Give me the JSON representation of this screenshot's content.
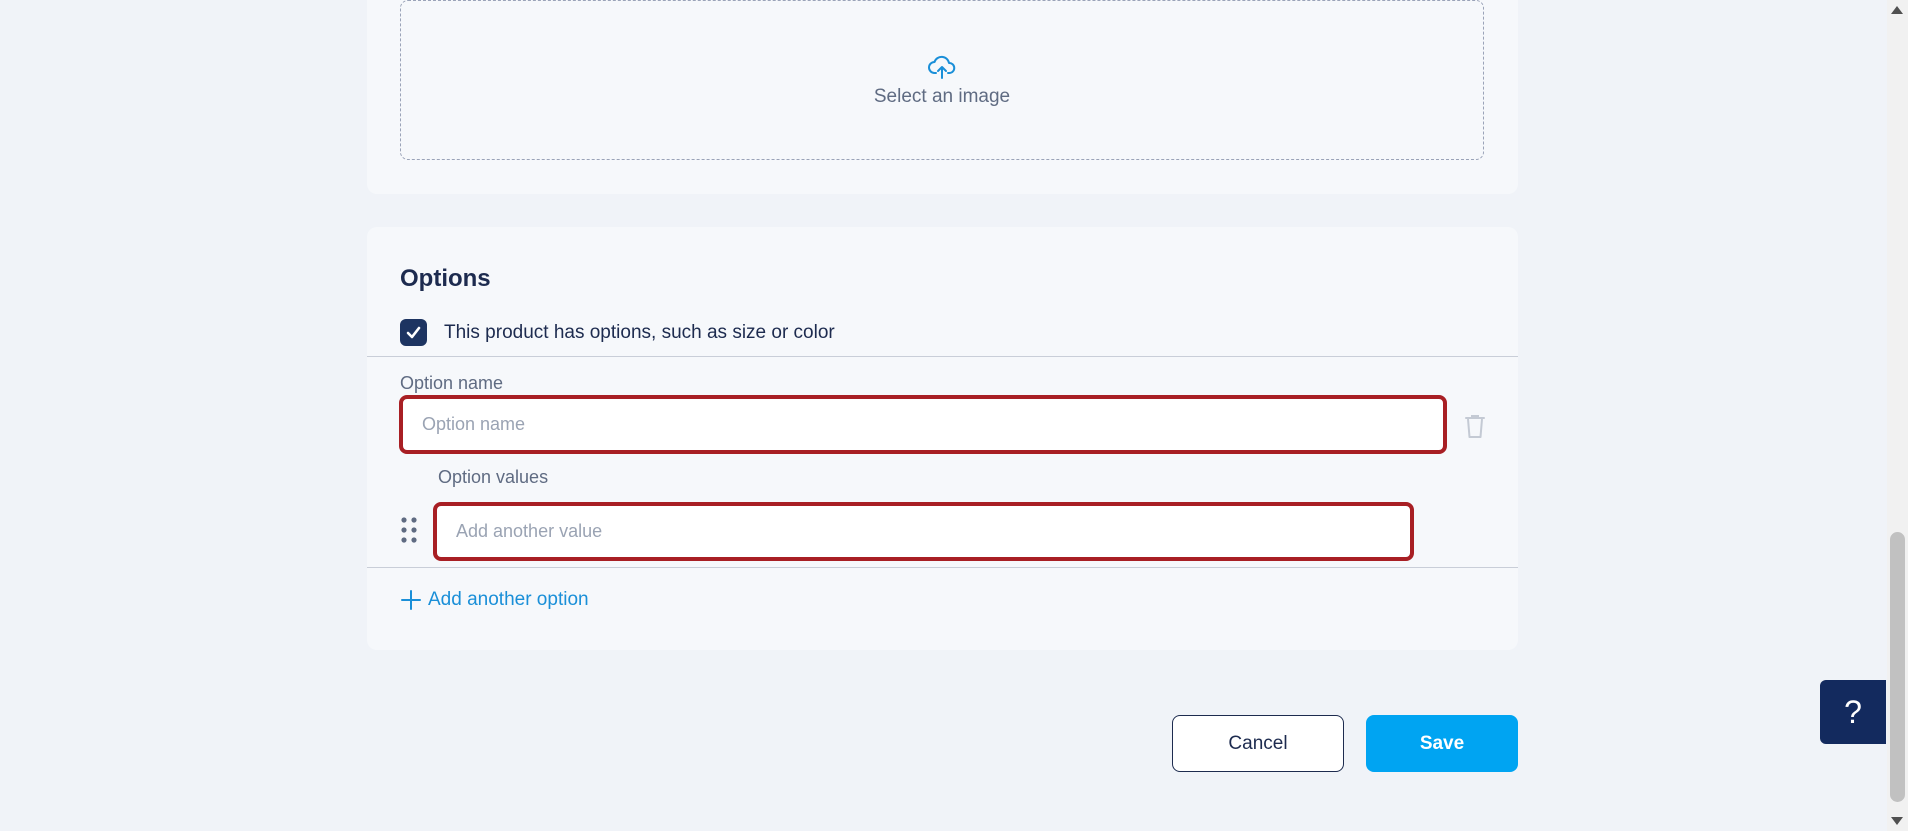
{
  "image_upload": {
    "label": "Select an image",
    "icon": "cloud-upload-icon",
    "accent": "#1a8fd8"
  },
  "options": {
    "title": "Options",
    "has_options_checkbox": {
      "label": "This product has options, such as size or color",
      "checked": true
    },
    "option_name": {
      "label": "Option name",
      "placeholder": "Option name",
      "value": ""
    },
    "option_values": {
      "label": "Option values",
      "placeholder": "Add another value",
      "value": ""
    },
    "add_option_label": "Add another option"
  },
  "actions": {
    "cancel_label": "Cancel",
    "save_label": "Save"
  },
  "help_button": {
    "label": "?"
  },
  "colors": {
    "error_border": "#a81f24",
    "primary": "#00a4f2",
    "link": "#1a8fd8",
    "navy": "#1d3461"
  }
}
